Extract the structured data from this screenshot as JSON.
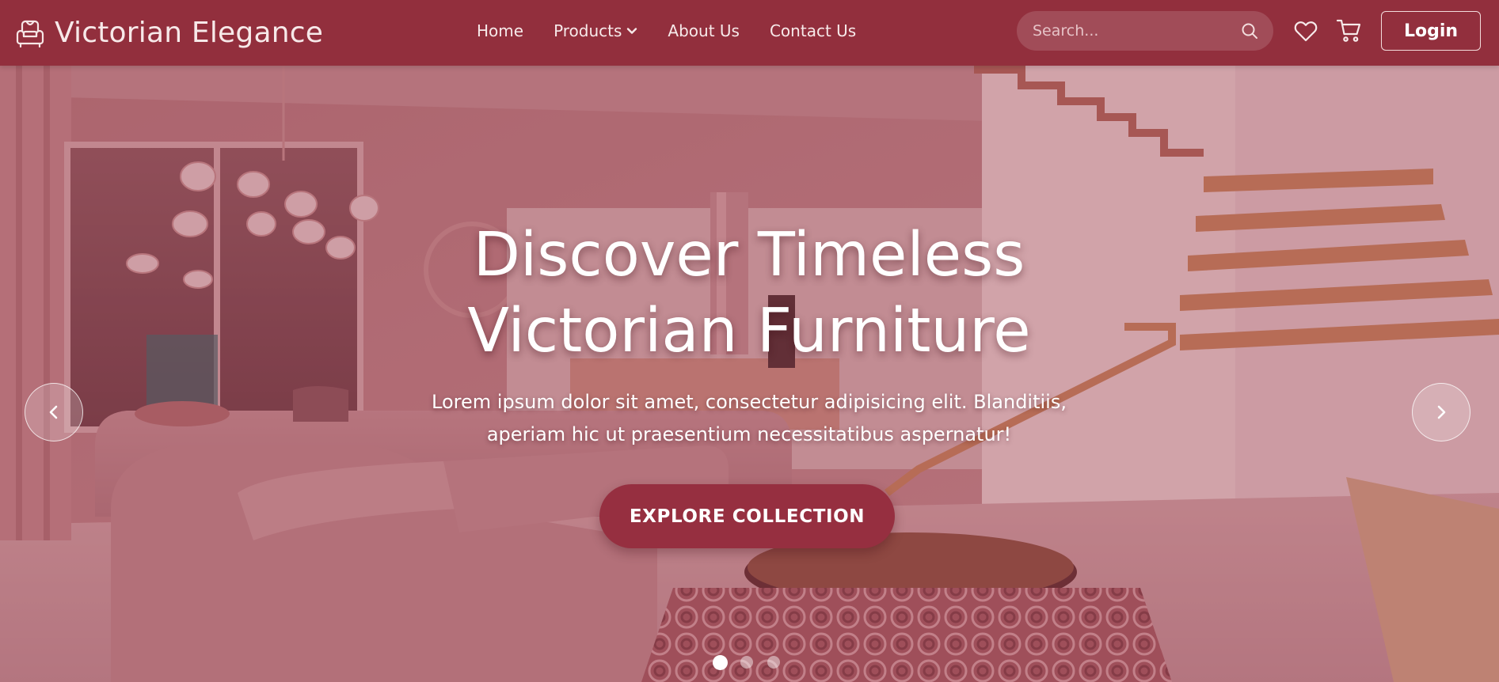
{
  "brand": {
    "name": "Victorian Elegance",
    "icon": "armchair-icon"
  },
  "nav": {
    "items": [
      {
        "label": "Home"
      },
      {
        "label": "Products",
        "icon": "chevron-down-icon"
      },
      {
        "label": "About Us"
      },
      {
        "label": "Contact Us"
      }
    ]
  },
  "search": {
    "placeholder": "Search...",
    "value": "",
    "icon": "search-icon"
  },
  "actions": {
    "wishlist_icon": "heart-icon",
    "cart_icon": "cart-icon",
    "login_label": "Login"
  },
  "hero": {
    "title_line1": "Discover Timeless",
    "title_line2": "Victorian Furniture",
    "subtitle_line1": "Lorem ipsum dolor sit amet, consectetur adipisicing elit. Blanditiis,",
    "subtitle_line2": "aperiam hic ut praesentium necessitatibus aspernatur!",
    "cta_label": "EXPLORE COLLECTION",
    "prev_icon": "chevron-left-icon",
    "next_icon": "chevron-right-icon",
    "slides_total": 3,
    "active_slide": 1
  },
  "colors": {
    "brand": "#922f3d",
    "cta": "#962f40",
    "text_light": "#f7eaea"
  }
}
